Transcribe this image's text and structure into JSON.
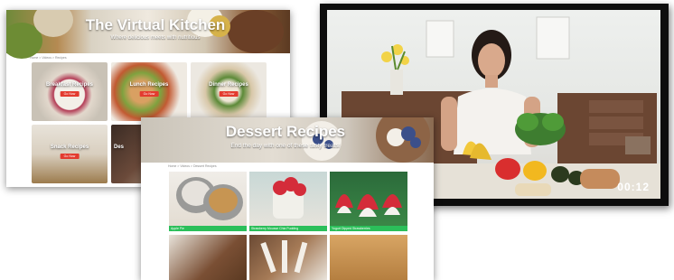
{
  "virtual_kitchen": {
    "title": "The Virtual Kitchen",
    "subtitle": "Where delicious meets with nutritious",
    "breadcrumb": "Home > Videos > Recipes",
    "cards": [
      {
        "label": "Breakfast Recipes",
        "button": "Go Now"
      },
      {
        "label": "Lunch Recipes",
        "button": "Go Now"
      },
      {
        "label": "Dinner Recipes",
        "button": "Go Now"
      },
      {
        "label": "Snack Recipes",
        "button": "Go Now"
      },
      {
        "label": "Des",
        "button": ""
      }
    ]
  },
  "video": {
    "timestamp": "00:12"
  },
  "dessert": {
    "title": "Dessert Recipes",
    "subtitle": "End the day with one of these tasty treats!",
    "breadcrumb": "Home > Videos > Dessert Recipes",
    "cards": [
      {
        "label": "Apple Pie"
      },
      {
        "label": "Strawberry Mousse Chia Pudding"
      },
      {
        "label": "Yogurt Dipped Strawberries"
      }
    ]
  },
  "colors": {
    "accent_green": "#2bbf5a",
    "button_red": "#e33b2f",
    "video_frame": "#0d0d0d"
  }
}
